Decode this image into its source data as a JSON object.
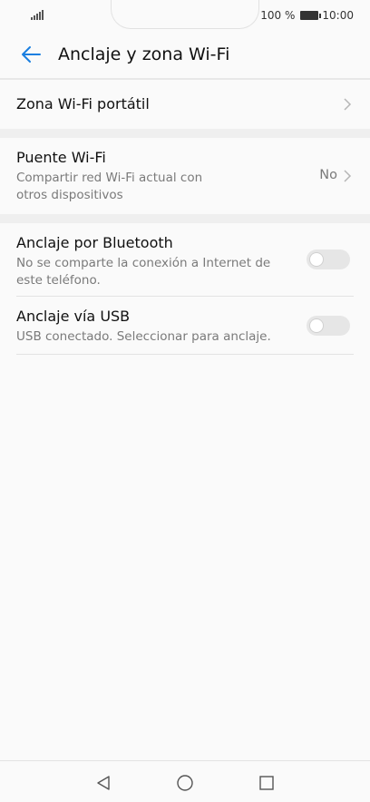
{
  "status_bar": {
    "battery_text": "100 %",
    "time": "10:00"
  },
  "header": {
    "title": "Anclaje y zona Wi-Fi",
    "back_icon": "arrow-left-icon",
    "accent_color": "#1a7fe0"
  },
  "items": [
    {
      "title": "Zona Wi-Fi portátil"
    },
    {
      "title": "Puente Wi-Fi",
      "subtitle_line1": "Compartir red Wi-Fi actual con",
      "subtitle_line2": "otros dispositivos",
      "value": "No"
    },
    {
      "title": "Anclaje por Bluetooth",
      "subtitle_line1": "No se comparte la conexión a Internet de",
      "subtitle_line2": "este teléfono.",
      "toggle": "off"
    },
    {
      "title": "Anclaje vía USB",
      "subtitle_line1": "USB conectado. Seleccionar para anclaje.",
      "toggle": "off"
    }
  ],
  "nav_bar": {
    "back": "triangle-back-icon",
    "home": "circle-home-icon",
    "recents": "square-recents-icon"
  }
}
